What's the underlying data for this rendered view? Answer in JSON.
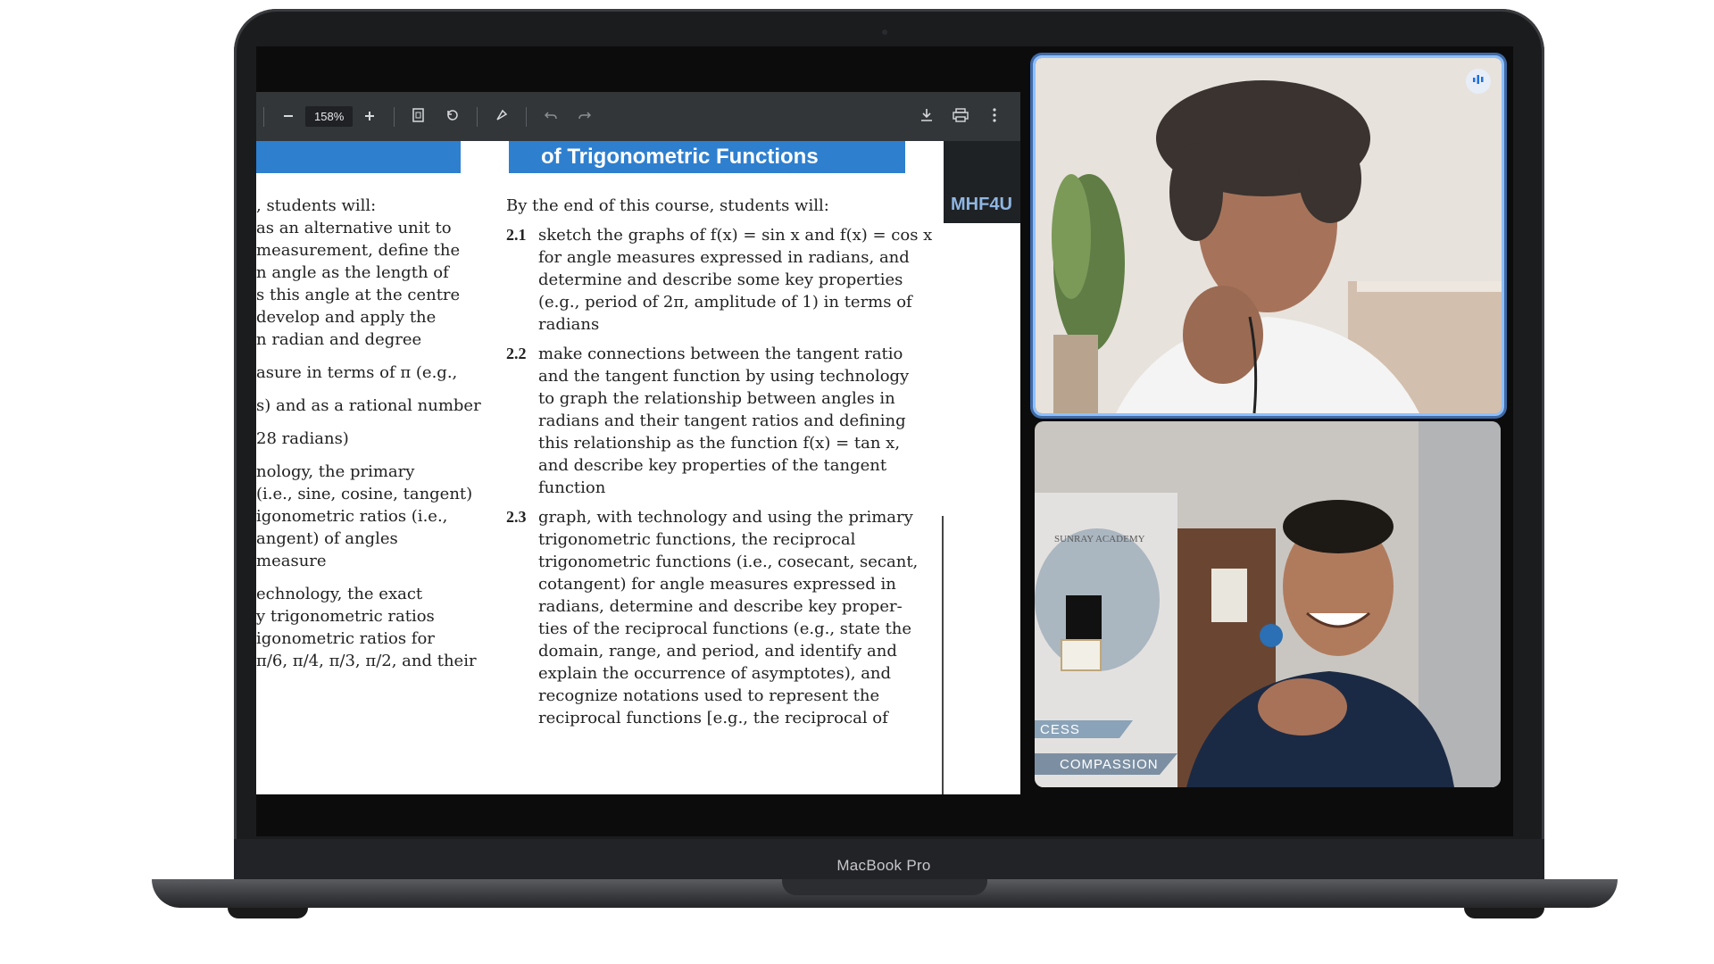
{
  "device": {
    "brand": "MacBook Pro"
  },
  "pdf_toolbar": {
    "zoom_value": "158%",
    "zoom_out_icon": "minus-icon",
    "zoom_in_icon": "plus-icon",
    "fit_icon": "fit-page-icon",
    "rotate_icon": "rotate-icon",
    "annotate_icon": "annotate-icon",
    "undo_icon": "undo-icon",
    "redo_icon": "redo-icon",
    "download_icon": "download-icon",
    "print_icon": "print-icon",
    "more_icon": "more-vertical-icon"
  },
  "document": {
    "right_header": "of Trigonometric Functions",
    "course_code": "MHF4U",
    "right_intro": "By the end of this course, students will:",
    "left_lines": [
      ", students will:",
      " as an alternative unit to",
      " measurement, define the",
      "n angle as the length of",
      "s this angle at the centre",
      "develop and apply the",
      "n radian and degree",
      "",
      "asure in terms of π (e.g.,",
      "",
      "s) and as a rational number",
      "",
      "28 radians)",
      "",
      "nology, the primary",
      "(i.e., sine, cosine, tangent)",
      "igonometric ratios (i.e.,",
      "angent) of angles",
      "measure",
      "",
      "echnology, the exact",
      "y trigonometric ratios",
      "igonometric ratios for",
      "π/6, π/4, π/3, π/2, and their"
    ],
    "items": [
      {
        "num": "2.1",
        "text": "sketch the graphs of f(x) = sin x and f(x) = cos x\nfor angle measures expressed in radians, and\ndetermine and describe some key properties\n(e.g., period of 2π, amplitude of 1) in terms of\nradians"
      },
      {
        "num": "2.2",
        "text": "make connections between the tangent ratio\nand the tangent function by using technology\nto graph the relationship between angles in\nradians and their tangent ratios and defining\nthis relationship as the function f(x) = tan x,\nand describe key properties of the tangent\nfunction"
      },
      {
        "num": "2.3",
        "text": "graph, with technology and using the primary\ntrigonometric functions, the reciprocal\ntrigonometric functions (i.e., cosecant, secant,\ncotangent) for angle measures expressed in\nradians, determine and describe key proper-\nties of the reciprocal functions (e.g., state the\ndomain, range, and period, and identify and\nexplain the occurrence of asymptotes), and\nrecognize notations used to represent the\nreciprocal functions [e.g., the reciprocal of"
      }
    ]
  },
  "video": {
    "tile1_badge_icon": "speaking-indicator-icon",
    "tile2_banner_text_top": "SUNRAY ACADEMY",
    "tile2_banner_text_1": "CESS",
    "tile2_banner_text_2": "COMPASSION"
  },
  "colors": {
    "header_blue": "#2f7fcf",
    "active_speaker_border": "#8ec0ff",
    "toolbar_bg": "#323639"
  }
}
